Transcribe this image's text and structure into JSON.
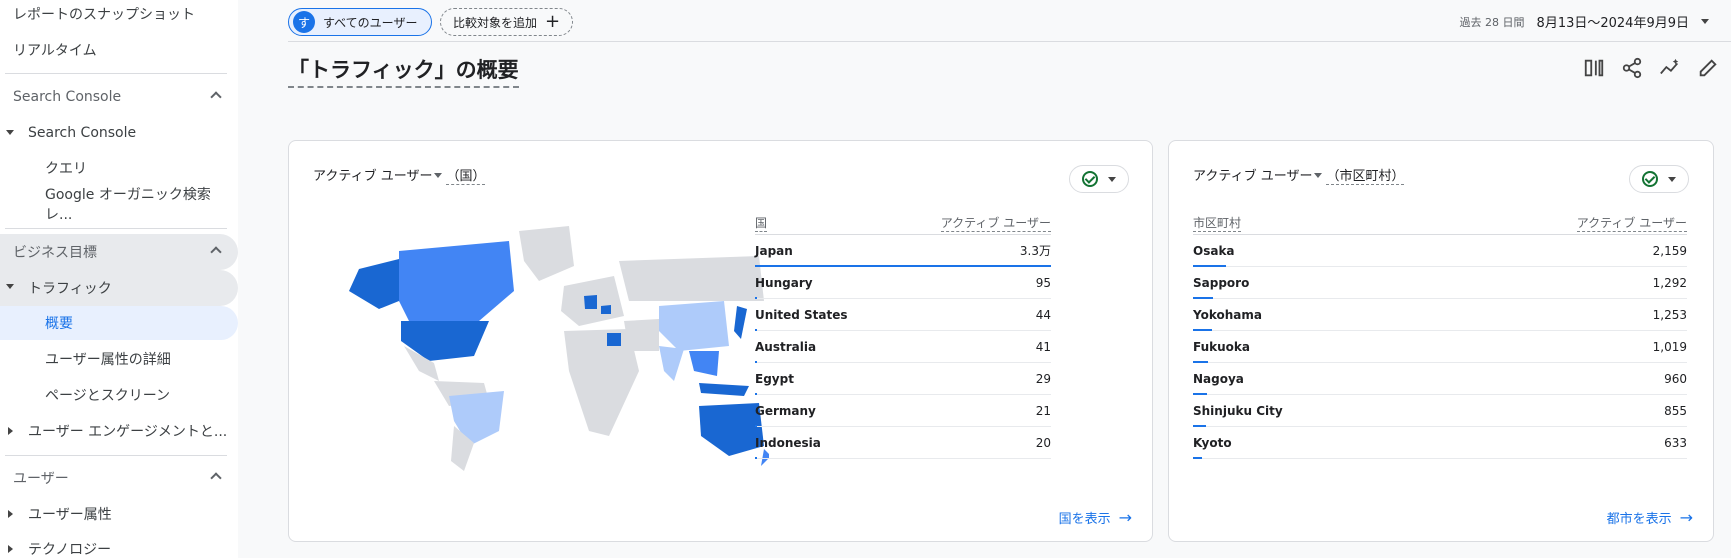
{
  "sidebar": {
    "top_items": [
      "レポートのスナップショット",
      "リアルタイム"
    ],
    "sections": [
      {
        "title": "Search Console",
        "group": "Search Console",
        "items": [
          "クエリ",
          "Google オーガニック検索レ..."
        ]
      },
      {
        "title": "ビジネス目標",
        "group": "トラフィック",
        "items": [
          "概要",
          "ユーザー属性の詳細",
          "ページとスクリーン"
        ],
        "collapsed_group": "ユーザー エンゲージメントと..."
      },
      {
        "title": "ユーザー",
        "groups": [
          "ユーザー属性",
          "テクノロジー"
        ]
      }
    ]
  },
  "header": {
    "user_chip": {
      "avatar": "す",
      "label": "すべてのユーザー"
    },
    "add_compare": "比較対象を追加",
    "date_label": "過去 28 日間",
    "date_range": "8月13日～2024年9月9日"
  },
  "page_title": "「トラフィック」の概要",
  "icons": {
    "toolbar": [
      "compare-columns-icon",
      "share-icon",
      "insights-icon",
      "edit-icon"
    ]
  },
  "card_country": {
    "title_metric": "アクティブ ユーザー",
    "title_dim": "（国）",
    "col_dim": "国",
    "col_metric": "アクティブ ユーザー",
    "rows": [
      {
        "name": "Japan",
        "value": "3.3万",
        "frac": 1.0
      },
      {
        "name": "Hungary",
        "value": "95",
        "frac": 0.003
      },
      {
        "name": "United States",
        "value": "44",
        "frac": 0.0015
      },
      {
        "name": "Australia",
        "value": "41",
        "frac": 0.0013
      },
      {
        "name": "Egypt",
        "value": "29",
        "frac": 0.001
      },
      {
        "name": "Germany",
        "value": "21",
        "frac": 0.0008
      },
      {
        "name": "Indonesia",
        "value": "20",
        "frac": 0.0007
      }
    ],
    "link": "国を表示"
  },
  "card_city": {
    "title_metric": "アクティブ ユーザー",
    "title_dim": "（市区町村）",
    "col_dim": "市区町村",
    "col_metric": "アクティブ ユーザー",
    "rows": [
      {
        "name": "Osaka",
        "value": "2,159",
        "frac": 0.066
      },
      {
        "name": "Sapporo",
        "value": "1,292",
        "frac": 0.04
      },
      {
        "name": "Yokohama",
        "value": "1,253",
        "frac": 0.038
      },
      {
        "name": "Fukuoka",
        "value": "1,019",
        "frac": 0.031
      },
      {
        "name": "Nagoya",
        "value": "960",
        "frac": 0.029
      },
      {
        "name": "Shinjuku City",
        "value": "855",
        "frac": 0.026
      },
      {
        "name": "Kyoto",
        "value": "633",
        "frac": 0.019
      }
    ],
    "link": "都市を表示"
  },
  "colors": {
    "accent": "#1a73e8",
    "map_dark": "#1967d2",
    "map_mid": "#4285f4",
    "map_light": "#aecbfa",
    "map_none": "#dadce0"
  }
}
